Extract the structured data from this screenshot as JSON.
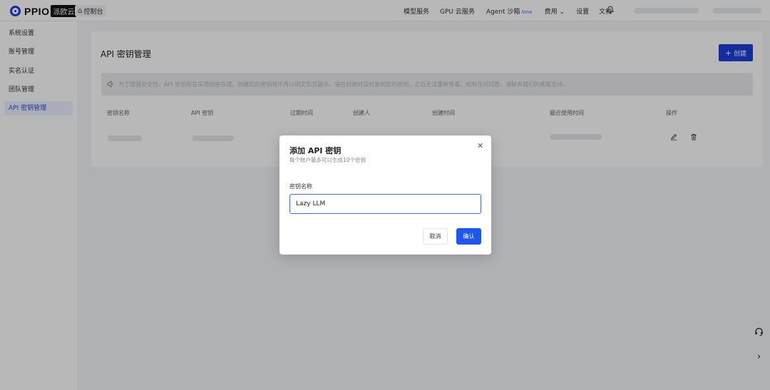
{
  "header": {
    "logo_text": "PPIO",
    "logo_tag": "派欧云",
    "console_label": "控制台",
    "nav": [
      {
        "label": "模型服务"
      },
      {
        "label": "GPU 云服务"
      },
      {
        "label": "Agent 沙箱",
        "badge": "New"
      },
      {
        "label": "费用 ⌄"
      },
      {
        "label": "设置"
      },
      {
        "label": "文档"
      }
    ]
  },
  "sidebar": {
    "items": [
      {
        "label": "系统设置"
      },
      {
        "label": "账号管理"
      },
      {
        "label": "实名认证"
      },
      {
        "label": "团队管理"
      },
      {
        "label": "API 密钥管理",
        "active": true
      }
    ]
  },
  "main": {
    "title": "API 密钥管理",
    "create_label": "创建",
    "notice": "为了增强安全性，API 密钥现在采用加密存储。创建后的密钥将不再以明文形式展示。请在创建时及时复制您的密钥，之后无法重新查看。如有任何问题，请联系我们的客服支持。",
    "table": {
      "columns": [
        "密钥名称",
        "API 密钥",
        "过期时间",
        "创建人",
        "创建时间",
        "最近使用时间",
        "操作"
      ]
    }
  },
  "modal": {
    "title": "添加 API 密钥",
    "subtitle": "每个账户最多可以生成10个密钥",
    "field_label": "密钥名称",
    "field_value": "Lazy LLM",
    "cancel_label": "取消",
    "confirm_label": "确认"
  },
  "colors": {
    "brand": "#1d3fd9",
    "primary_button": "#1f55f0",
    "input_focus": "#3e67f2"
  }
}
